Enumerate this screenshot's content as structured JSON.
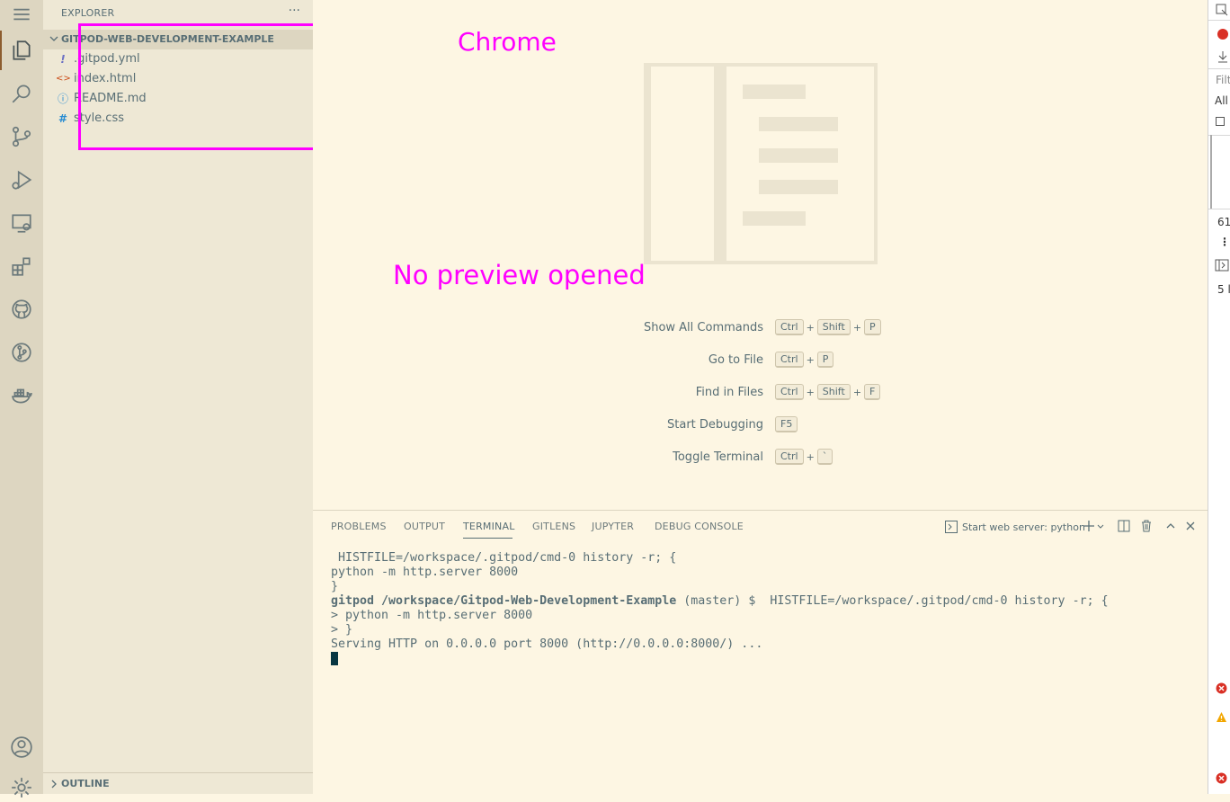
{
  "activity_bar": {
    "items": [
      "explorer-icon",
      "search-icon",
      "source-control-icon",
      "run-debug-icon",
      "remote-explorer-icon",
      "extensions-icon",
      "github-icon",
      "gitlens-icon",
      "docker-icon"
    ],
    "bottom": [
      "account-icon",
      "settings-gear-icon"
    ]
  },
  "sidebar": {
    "title": "EXPLORER",
    "more": "···",
    "folder": "GITPOD-WEB-DEVELOPMENT-EXAMPLE",
    "files": [
      {
        "name": ".gitpod.yml",
        "icon": "!",
        "color": "#6c71c4"
      },
      {
        "name": "index.html",
        "icon": "<>",
        "color": "#cb4b16"
      },
      {
        "name": "README.md",
        "icon": "ⓘ",
        "color": "#268bd2"
      },
      {
        "name": "style.css",
        "icon": "#",
        "color": "#268bd2"
      }
    ],
    "outline": "OUTLINE"
  },
  "editor": {
    "annotation_chrome": "Chrome",
    "annotation_preview": "No preview opened",
    "shortcuts": [
      {
        "label": "Show All Commands",
        "keys": [
          "Ctrl",
          "Shift",
          "P"
        ]
      },
      {
        "label": "Go to File",
        "keys": [
          "Ctrl",
          "P"
        ]
      },
      {
        "label": "Find in Files",
        "keys": [
          "Ctrl",
          "Shift",
          "F"
        ]
      },
      {
        "label": "Start Debugging",
        "keys": [
          "F5"
        ]
      },
      {
        "label": "Toggle Terminal",
        "keys": [
          "Ctrl",
          "`"
        ]
      }
    ]
  },
  "panel": {
    "tabs": [
      "PROBLEMS",
      "OUTPUT",
      "TERMINAL",
      "GITLENS",
      "JUPYTER",
      "DEBUG CONSOLE"
    ],
    "active_tab": "TERMINAL",
    "terminal_selector": "Start web server: python",
    "terminal": {
      "line1": " HISTFILE=/workspace/.gitpod/cmd-0 history -r; {",
      "line2": "python -m http.server 8000",
      "line3": "}",
      "prompt_user": "gitpod /workspace/Gitpod-Web-Development-Example",
      "prompt_rest": " (master) $  HISTFILE=/workspace/.gitpod/cmd-0 history -r; {",
      "line5": "> python -m http.server 8000",
      "line6": "> }",
      "line7": "Serving HTTP on 0.0.0.0 port 8000 (http://0.0.0.0:8000/) ..."
    }
  },
  "devtools": {
    "filter": "Filt",
    "all": "All",
    "num1": "61",
    "num2": "5 l"
  },
  "colors": {
    "highlight": "#ff00ff",
    "background": "#fdf6e3",
    "sidebar": "#eee8d5",
    "activity_bar": "#ddd6c1"
  }
}
